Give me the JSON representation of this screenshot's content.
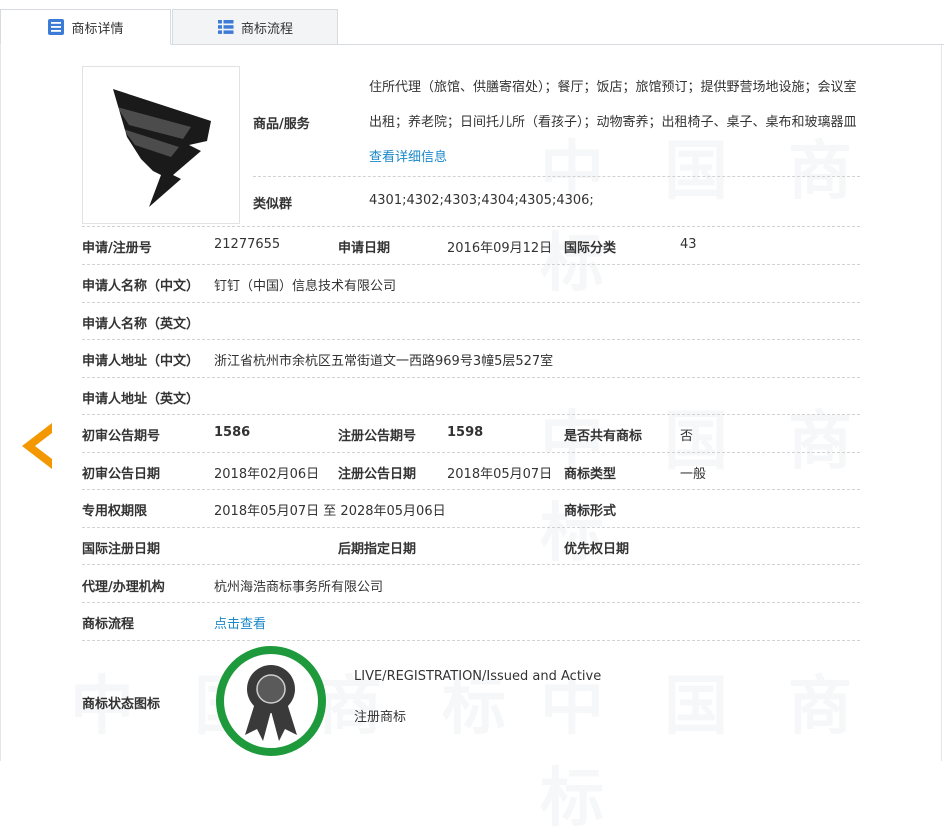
{
  "tabs": [
    {
      "label": "商标详情",
      "icon": "document-list-icon",
      "active": true
    },
    {
      "label": "商标流程",
      "icon": "grid-list-icon",
      "active": false
    }
  ],
  "watermark": {
    "text1": "中国商标"
  },
  "goods": {
    "label": "商品/服务",
    "text": "住所代理（旅馆、供膳寄宿处）；餐厅；饭店；旅馆预订；提供野营场地设施；会议室出租；养老院；日间托儿所（看孩子）；动物寄养；出租椅子、桌子、桌布和玻璃器皿",
    "more_link": "查看详细信息"
  },
  "similar_group": {
    "label": "类似群",
    "value": "4301;4302;4303;4304;4305;4306;"
  },
  "rows": {
    "reg_no_label": "申请/注册号",
    "reg_no": "21277655",
    "apply_date_label": "申请日期",
    "apply_date": "2016年09月12日",
    "intl_class_label": "国际分类",
    "intl_class": "43",
    "applicant_cn_label": "申请人名称（中文）",
    "applicant_cn": "钉钉（中国）信息技术有限公司",
    "applicant_en_label": "申请人名称（英文）",
    "applicant_en": "",
    "address_cn_label": "申请人地址（中文）",
    "address_cn": "浙江省杭州市余杭区五常街道文一西路969号3幢5层527室",
    "address_en_label": "申请人地址（英文）",
    "address_en": "",
    "prelim_no_label": "初审公告期号",
    "prelim_no": "1586",
    "reg_pub_no_label": "注册公告期号",
    "reg_pub_no": "1598",
    "shared_label": "是否共有商标",
    "shared": "否",
    "prelim_date_label": "初审公告日期",
    "prelim_date": "2018年02月06日",
    "reg_pub_date_label": "注册公告日期",
    "reg_pub_date": "2018年05月07日",
    "tm_type_label": "商标类型",
    "tm_type": "一般",
    "exclusive_label": "专用权期限",
    "exclusive": "2018年05月07日 至 2028年05月06日",
    "tm_form_label": "商标形式",
    "tm_form": "",
    "intl_reg_date_label": "国际注册日期",
    "intl_reg_date": "",
    "later_date_label": "后期指定日期",
    "later_date": "",
    "priority_date_label": "优先权日期",
    "priority_date": "",
    "agent_label": "代理/办理机构",
    "agent": "杭州海浩商标事务所有限公司",
    "flow_label": "商标流程",
    "flow_link": "点击查看",
    "status_label": "商标状态图标",
    "status_en": "LIVE/REGISTRATION/Issued and Active",
    "status_cn": "注册商标"
  },
  "colors": {
    "link": "#1b88c9",
    "arrow": "#f39800",
    "badge_ring": "#1e9a3c"
  }
}
